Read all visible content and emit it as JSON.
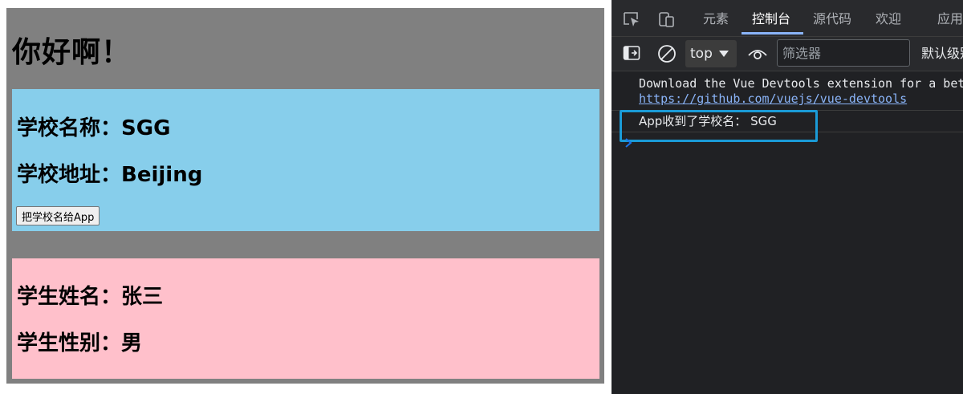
{
  "app": {
    "title": "你好啊！",
    "school": {
      "name_text": "学校名称：SGG",
      "address_text": "学校地址：Beijing",
      "button_label": "把学校名给App"
    },
    "student": {
      "name_text": "学生姓名：张三",
      "gender_text": "学生性别：男"
    },
    "colors": {
      "app_bg": "#808080",
      "school_bg": "#87ceeb",
      "student_bg": "#ffc0cb"
    }
  },
  "devtools": {
    "tabs": [
      {
        "label": "元素",
        "active": false
      },
      {
        "label": "控制台",
        "active": true
      },
      {
        "label": "源代码",
        "active": false
      },
      {
        "label": "欢迎",
        "active": false
      },
      {
        "label": "应用",
        "active": false
      }
    ],
    "toolbar": {
      "context": "top",
      "filter_placeholder": "筛选器",
      "levels": "默认级别"
    },
    "console": {
      "messages": [
        {
          "text": "Download the Vue Devtools extension for a better development experience:",
          "link": "https://github.com/vuejs/vue-devtools"
        },
        {
          "text": "App收到了学校名：  SGG"
        }
      ]
    },
    "icons": [
      "inspect-icon",
      "device-toggle-icon",
      "sidebar-toggle-icon",
      "clear-console-icon",
      "dropdown-arrow-icon",
      "live-expression-eye-icon",
      "prompt-chevron-icon"
    ],
    "colors": {
      "background": "#202124",
      "active_tab_underline": "#8ab4f8",
      "highlight_box": "#1a9bd7",
      "link": "#8ab4f8"
    }
  }
}
